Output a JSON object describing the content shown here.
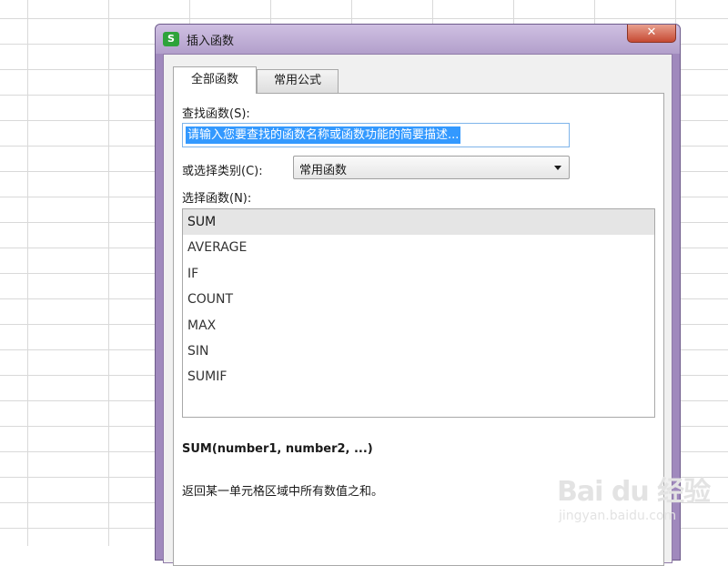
{
  "dialog": {
    "title": "插入函数",
    "app_icon": "S",
    "close_glyph": "✕",
    "tabs": [
      {
        "label": "全部函数",
        "active": true
      },
      {
        "label": "常用公式",
        "active": false
      }
    ],
    "search": {
      "label": "查找函数(S):",
      "value": "请输入您要查找的函数名称或函数功能的简要描述..."
    },
    "category": {
      "label": "或选择类别(C):",
      "selected": "常用函数"
    },
    "functions": {
      "label": "选择函数(N):",
      "items": [
        "SUM",
        "AVERAGE",
        "IF",
        "COUNT",
        "MAX",
        "SIN",
        "SUMIF"
      ],
      "selected_index": 0
    },
    "signature": "SUM(number1, number2, ...)",
    "description": "返回某一单元格区域中所有数值之和。"
  },
  "watermark": {
    "logo": "Bai du 经验",
    "url": "jingyan.baidu.com"
  },
  "colors": {
    "dialog_frame": "#a089bd",
    "selection": "#3399ff",
    "close_button": "#c64a33"
  }
}
